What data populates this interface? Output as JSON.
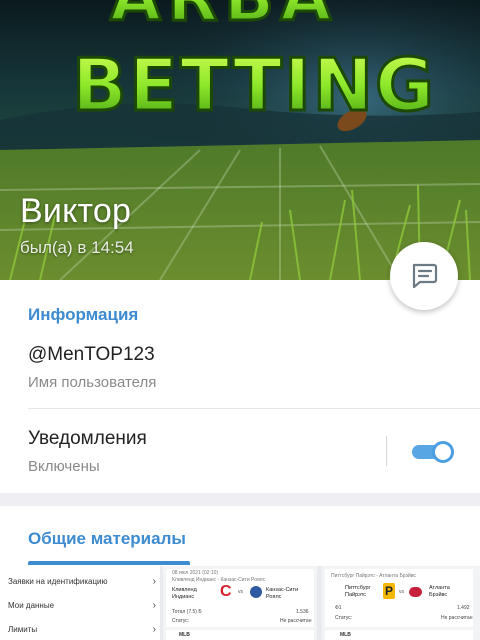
{
  "profile": {
    "banner_text_top": "ARBA",
    "banner_text_main": "BETTING",
    "name": "Виктор",
    "status": "был(а) в 14:54"
  },
  "info": {
    "section_title": "Информация",
    "username": "@MenTOP123",
    "username_caption": "Имя пользователя",
    "notifications_label": "Уведомления",
    "notifications_state": "Включены",
    "notifications_on": true
  },
  "media": {
    "section_title": "Общие материалы",
    "menu_thumb": {
      "items": [
        "Заявки на идентификацию",
        "Мои данные",
        "Лимиты"
      ],
      "chevron": "›"
    },
    "card1": {
      "date": "08 июл 2021 (02:10)",
      "title": "Кливленд Индианс - Канзас-Сити Роялс",
      "team1": "Кливленд Индианс",
      "team2": "Канзас-Сити Роялс",
      "vs": "vs",
      "bet": "Тотал (7.5) Б",
      "odds": "1.536",
      "status_label": "Статус:",
      "status_value": "Не рассчитан",
      "footer": "MLB"
    },
    "card2": {
      "title": "Питтсбург Пайрэтс - Атланта Брэйвс",
      "team1": "Питтсбург Пайрэтс",
      "team2": "Атланта Брэйвс",
      "vs": "vs",
      "bet": "Ф1",
      "odds": "1.492",
      "status_label": "Статус:",
      "status_value": "Не рассчитан",
      "footer": "MLB"
    }
  },
  "colors": {
    "accent": "#3d8bd0",
    "toggle": "#58a6e3",
    "banner_green": "#8ee82a",
    "text_primary": "#222222",
    "text_secondary": "#8a8a8a"
  },
  "icons": {
    "message_button": "message-lines-icon",
    "chevron": "chevron-right-icon"
  }
}
